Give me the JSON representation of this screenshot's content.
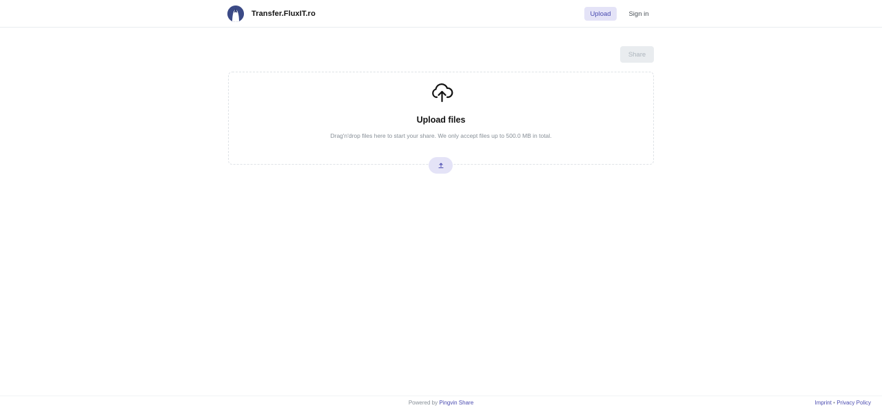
{
  "header": {
    "brand_name": "Transfer.FluxIT.ro",
    "logo_icon": "penguin-logo-icon",
    "nav": {
      "upload_label": "Upload",
      "signin_label": "Sign in"
    }
  },
  "toolbar": {
    "share_label": "Share"
  },
  "dropzone": {
    "icon": "cloud-upload-icon",
    "title": "Upload files",
    "description": "Drag'n'drop files here to start your share. We only accept files up to 500.0 MB in total.",
    "button_icon": "upload-icon"
  },
  "footer": {
    "powered_prefix": "Powered by",
    "powered_link": "Pingvin Share",
    "imprint_label": "Imprint",
    "separator": "•",
    "privacy_label": "Privacy Policy"
  },
  "colors": {
    "accent": "#4a4bb0",
    "accent_light": "#e4e3f7",
    "logo_bg": "#3b4a86",
    "disabled_bg": "#e9ecef",
    "disabled_text": "#adb5bd"
  }
}
